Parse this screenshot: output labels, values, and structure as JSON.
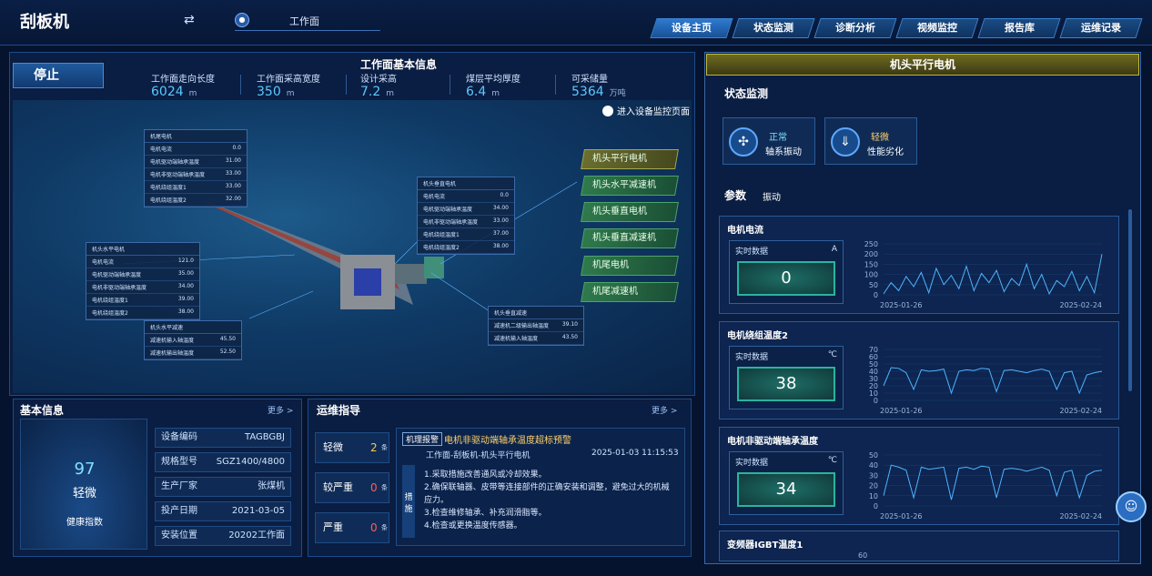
{
  "app_title": "刮板机",
  "workface_label": "工作面",
  "nav": [
    "设备主页",
    "状态监测",
    "诊断分析",
    "视频监控",
    "报告库",
    "运维记录"
  ],
  "status_badge": "停止",
  "info": {
    "title": "工作面基本信息",
    "stats": [
      {
        "label": "工作面走向长度",
        "value": "6024",
        "unit": "m"
      },
      {
        "label": "工作面采高宽度",
        "value": "350",
        "unit": "m"
      },
      {
        "label": "设计采高",
        "value": "7.2",
        "unit": "m"
      },
      {
        "label": "煤层平均厚度",
        "value": "6.4",
        "unit": "m"
      },
      {
        "label": "可采储量",
        "value": "5364",
        "unit": "万吨"
      }
    ]
  },
  "enter_monitor": "进入设备监控页面",
  "motors": [
    "机头平行电机",
    "机头水平减速机",
    "机头垂直电机",
    "机头垂直减速机",
    "机尾电机",
    "机尾减速机"
  ],
  "boxes": {
    "tail_motor": {
      "title": "机尾电机",
      "rows": [
        [
          "电机电流",
          "0.0"
        ],
        [
          "电机驱动端轴承温度",
          "31.00"
        ],
        [
          "电机非驱动端轴承温度",
          "33.00"
        ],
        [
          "电机绕组温度1",
          "33.00"
        ],
        [
          "电机绕组温度2",
          "32.00"
        ]
      ]
    },
    "vertical_motor": {
      "title": "机头垂直电机",
      "rows": [
        [
          "电机电流",
          "0.0"
        ],
        [
          "电机驱动端轴承温度",
          "34.00"
        ],
        [
          "电机非驱动端轴承温度",
          "33.00"
        ],
        [
          "电机绕组温度1",
          "37.00"
        ],
        [
          "电机绕组温度2",
          "38.00"
        ]
      ]
    },
    "horizontal_motor": {
      "title": "机头水平电机",
      "rows": [
        [
          "电机电流",
          "121.0"
        ],
        [
          "电机驱动端轴承温度",
          "35.00"
        ],
        [
          "电机非驱动端轴承温度",
          "34.00"
        ],
        [
          "电机绕组温度1",
          "39.00"
        ],
        [
          "电机绕组温度2",
          "38.00"
        ]
      ]
    },
    "horizontal_reducer": {
      "title": "机头水平减速",
      "rows": [
        [
          "减速机输入轴温度",
          "45.50"
        ],
        [
          "减速机输出轴温度",
          "52.50"
        ]
      ]
    },
    "vertical_reducer": {
      "title": "机头垂直减速",
      "rows": [
        [
          "减速机二级输出轴温度",
          "39.10"
        ],
        [
          "减速机输入轴温度",
          "43.50"
        ]
      ]
    }
  },
  "basic": {
    "title": "基本信息",
    "more": "更多 >",
    "score": "97",
    "level": "轻微",
    "health_label": "健康指数",
    "fields": [
      {
        "k": "设备编码",
        "v": "TAGBGBJ"
      },
      {
        "k": "规格型号",
        "v": "SGZ1400/4800"
      },
      {
        "k": "生产厂家",
        "v": "张煤机"
      },
      {
        "k": "投产日期",
        "v": "2021-03-05"
      },
      {
        "k": "安装位置",
        "v": "20202工作面"
      }
    ]
  },
  "maint": {
    "title": "运维指导",
    "more": "更多 >",
    "levels": [
      {
        "label": "轻微",
        "count": "2",
        "unit": "条"
      },
      {
        "label": "较严重",
        "count": "0",
        "unit": "条"
      },
      {
        "label": "严重",
        "count": "0",
        "unit": "条"
      }
    ],
    "alarm": {
      "tag": "机理报警",
      "title": "电机非驱动端轴承温度超标预警",
      "path": "工作面-刮板机-机头平行电机",
      "time": "2025-01-03 11:15:53",
      "measure_label": "措施",
      "steps": [
        "1.采取措施改善通风或冷却效果。",
        "2.确保联轴器、皮带等连接部件的正确安装和调整，避免过大的机械应力。",
        "3.检查维修轴承、补充润滑脂等。",
        "4.检查或更换温度传感器。"
      ]
    }
  },
  "right": {
    "title": "机头平行电机",
    "status_title": "状态监测",
    "status": [
      {
        "state": "正常",
        "name": "轴系振动"
      },
      {
        "state": "轻微",
        "name": "性能劣化"
      }
    ],
    "param_title": "参数",
    "param_tab": "振动",
    "realtime_label": "实时数据",
    "cards": [
      {
        "title": "电机电流",
        "unit": "A",
        "value": "0",
        "yticks": [
          "250",
          "200",
          "150",
          "100",
          "50",
          "0"
        ],
        "x_start": "2025-01-26",
        "x_end": "2025-02-24"
      },
      {
        "title": "电机绕组温度2",
        "unit": "℃",
        "value": "38",
        "yticks": [
          "70",
          "60",
          "50",
          "40",
          "30",
          "20",
          "10",
          "0"
        ],
        "x_start": "2025-01-26",
        "x_end": "2025-02-24"
      },
      {
        "title": "电机非驱动端轴承温度",
        "unit": "℃",
        "value": "34",
        "yticks": [
          "50",
          "40",
          "30",
          "20",
          "10",
          "0"
        ],
        "x_start": "2025-01-26",
        "x_end": "2025-02-24"
      },
      {
        "title": "变频器IGBT温度1",
        "unit": "",
        "value": "",
        "yticks": [
          "60"
        ],
        "x_start": "",
        "x_end": ""
      }
    ]
  },
  "chart_data": [
    {
      "type": "line",
      "title": "电机电流",
      "xlabel": "",
      "ylabel": "",
      "ylim": [
        0,
        250
      ],
      "x": [
        "2025-01-26",
        "2025-02-24"
      ],
      "series": [
        {
          "values": [
            5,
            60,
            20,
            90,
            40,
            110,
            10,
            130,
            50,
            95,
            30,
            140,
            20,
            105,
            60,
            120,
            15,
            80,
            45,
            150,
            30,
            100,
            5,
            70,
            40,
            115,
            20,
            90,
            10,
            200
          ]
        }
      ]
    },
    {
      "type": "line",
      "title": "电机绕组温度2",
      "xlabel": "",
      "ylabel": "",
      "ylim": [
        0,
        70
      ],
      "x": [
        "2025-01-26",
        "2025-02-24"
      ],
      "series": [
        {
          "values": [
            20,
            45,
            44,
            38,
            15,
            42,
            40,
            41,
            43,
            10,
            40,
            42,
            41,
            44,
            43,
            12,
            41,
            42,
            40,
            38,
            41,
            43,
            40,
            15,
            38,
            40,
            10,
            35,
            38,
            40
          ]
        }
      ]
    },
    {
      "type": "line",
      "title": "电机非驱动端轴承温度",
      "xlabel": "",
      "ylabel": "",
      "ylim": [
        0,
        50
      ],
      "x": [
        "2025-01-26",
        "2025-02-24"
      ],
      "series": [
        {
          "values": [
            10,
            40,
            38,
            35,
            8,
            38,
            36,
            37,
            38,
            6,
            37,
            38,
            36,
            39,
            38,
            8,
            36,
            37,
            36,
            34,
            36,
            38,
            35,
            10,
            33,
            35,
            8,
            30,
            34,
            35
          ]
        }
      ]
    }
  ]
}
